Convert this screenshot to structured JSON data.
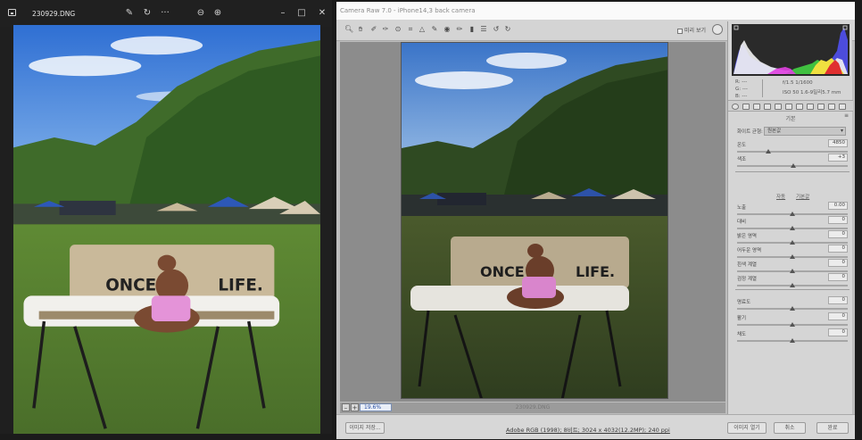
{
  "viewer": {
    "filename": "230929.DNG",
    "icons": [
      "app-icon",
      "edit-icon",
      "rotate-icon",
      "more-icon",
      "zoom-out-icon",
      "zoom-in-icon",
      "minimize-icon",
      "maximize-icon",
      "close-icon"
    ]
  },
  "camera_raw": {
    "title": "Camera Raw 7.0  -  iPhone14,3 back camera",
    "toolbar": {
      "preview_label": "미리 보기",
      "tools": [
        "zoom-icon",
        "hand-icon",
        "white-balance-icon",
        "color-sampler-icon",
        "target-adjust-icon",
        "crop-icon",
        "straighten-icon",
        "spot-removal-icon",
        "red-eye-icon",
        "adjustment-brush-icon",
        "graduated-filter-icon",
        "preferences-icon",
        "rotate-ccw-icon",
        "rotate-cw-icon"
      ]
    },
    "canvas": {
      "zoom_value": "19.6%",
      "filename": "230929.DNG"
    },
    "footer": {
      "save_image": "이미지 저장...",
      "workflow": "Adobe RGB (1998); 8비트; 3024 x 4032(12.2MP); 240 ppi",
      "open_image": "이미지 열기",
      "cancel": "취소",
      "done": "완료"
    },
    "panel": {
      "readout": {
        "r": "R:  ---",
        "g": "G:  ---",
        "b": "B:  ---",
        "exif_line1": "f/1.5   1/1600",
        "exif_line2": "ISO 50   1.6-9밀리5.7 mm"
      },
      "panel_name": "기본",
      "white_balance_label": "화이트 균형:",
      "white_balance_value": "원본값",
      "auto_label": "자동",
      "default_label": "기본값",
      "sliders": [
        {
          "label": "온도",
          "value": "4850",
          "position": 0.28
        },
        {
          "label": "색조",
          "value": "+3",
          "position": 0.51
        },
        {
          "label": "노출",
          "value": "0.00",
          "position": 0.5
        },
        {
          "label": "대비",
          "value": "0",
          "position": 0.5
        },
        {
          "label": "밝은 영역",
          "value": "0",
          "position": 0.5
        },
        {
          "label": "어두운 영역",
          "value": "0",
          "position": 0.5
        },
        {
          "label": "흰색 계열",
          "value": "0",
          "position": 0.5
        },
        {
          "label": "검정 계열",
          "value": "0",
          "position": 0.5
        },
        {
          "label": "명료도",
          "value": "0",
          "position": 0.5
        },
        {
          "label": "활기",
          "value": "0",
          "position": 0.5
        },
        {
          "label": "채도",
          "value": "0",
          "position": 0.5
        }
      ]
    }
  },
  "photo": {
    "bench_text": "ONCE IN A LIFE."
  }
}
